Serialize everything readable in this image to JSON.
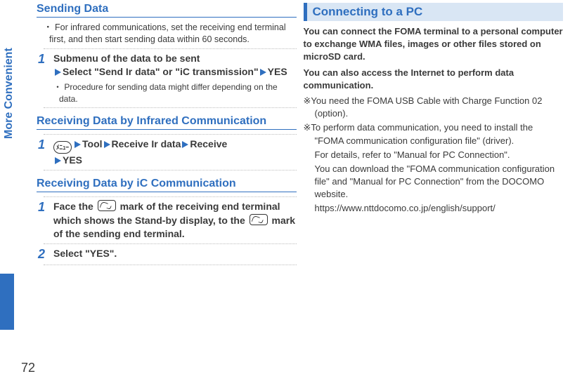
{
  "side_label": "More Convenient",
  "page_number": "72",
  "left": {
    "h_sending": "Sending Data",
    "bullet_sending": "For infrared communications, set the receiving end terminal first, and then start sending data within 60 seconds.",
    "step1_num": "1",
    "step1_line1": "Submenu of the data to be sent",
    "step1_select": "Select \"Send Ir data\" or \"iC transmission\"",
    "step1_yes": "YES",
    "step1_sub": "Procedure for sending data might differ depending on the data.",
    "h_recv_ir": "Receiving Data by Infrared Communication",
    "ir_step_num": "1",
    "ir_tool": "Tool",
    "ir_receive": "Receive Ir data",
    "ir_receive2": "Receive",
    "ir_yes": "YES",
    "h_recv_ic": "Receiving Data by iC Communication",
    "ic1_num": "1",
    "ic1_a": "Face the ",
    "ic1_b": " mark of the receiving end terminal which shows the Stand-by display, to the ",
    "ic1_c": " mark of the sending end terminal.",
    "ic2_num": "2",
    "ic2_body": "Select \"YES\"."
  },
  "right": {
    "h_connect": "Connecting to a PC",
    "intro1": "You can connect the FOMA terminal to a personal computer to exchange WMA files, images or other files stored on microSD card.",
    "intro2": "You can also access the Internet to perform data communication.",
    "note1_pre": "※",
    "note1": "You need the FOMA USB Cable with Charge Function 02 (option).",
    "note2_pre": "※",
    "note2": "To perform data communication, you need to install the \"FOMA communication configuration file\" (driver).",
    "note2b": "For details, refer to \"Manual for PC Connection\".",
    "note2c": "You can download the \"FOMA communication configuration file\" and \"Manual for PC Connection\" from the DOCOMO website.",
    "note2d": "https://www.nttdocomo.co.jp/english/support/"
  }
}
